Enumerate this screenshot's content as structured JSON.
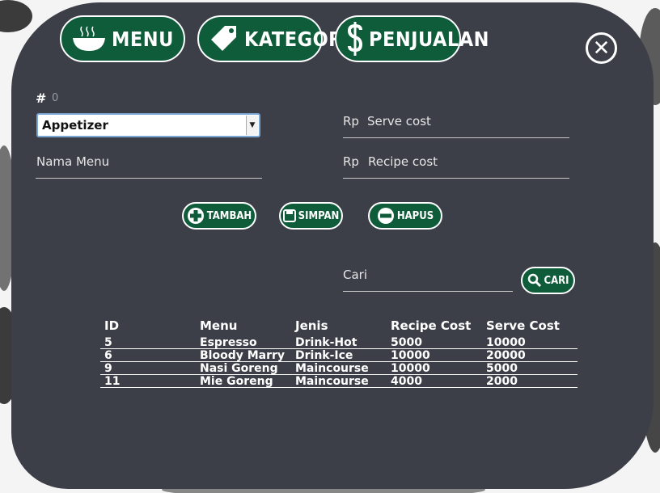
{
  "nav": {
    "menu_label": "MENU",
    "kategori_label": "KATEGORI",
    "penjualan_label": "PENJUALAN"
  },
  "form": {
    "hash_label": "#",
    "id_value": "0",
    "category_selected": "Appetizer",
    "menu_name_placeholder": "Nama Menu",
    "currency_prefix": "Rp",
    "serve_cost_placeholder": "Serve cost",
    "recipe_cost_placeholder": "Recipe cost"
  },
  "actions": {
    "add_label": "TAMBAH",
    "save_label": "SIMPAN",
    "delete_label": "HAPUS"
  },
  "search": {
    "placeholder": "Cari",
    "button_label": "CARI"
  },
  "table": {
    "headers": [
      "ID",
      "Menu",
      "Jenis",
      "Recipe Cost",
      "Serve Cost"
    ],
    "rows": [
      [
        "5",
        "Espresso",
        "Drink-Hot",
        "5000",
        "10000"
      ],
      [
        "6",
        "Bloody Marry",
        "Drink-Ice",
        "10000",
        "20000"
      ],
      [
        "9",
        "Nasi Goreng",
        "Maincourse",
        "10000",
        "5000"
      ],
      [
        "11",
        "Mie Goreng",
        "Maincourse",
        "4000",
        "2000"
      ]
    ]
  },
  "colors": {
    "panel": "#3c3f48",
    "button": "#0e5c3a"
  }
}
